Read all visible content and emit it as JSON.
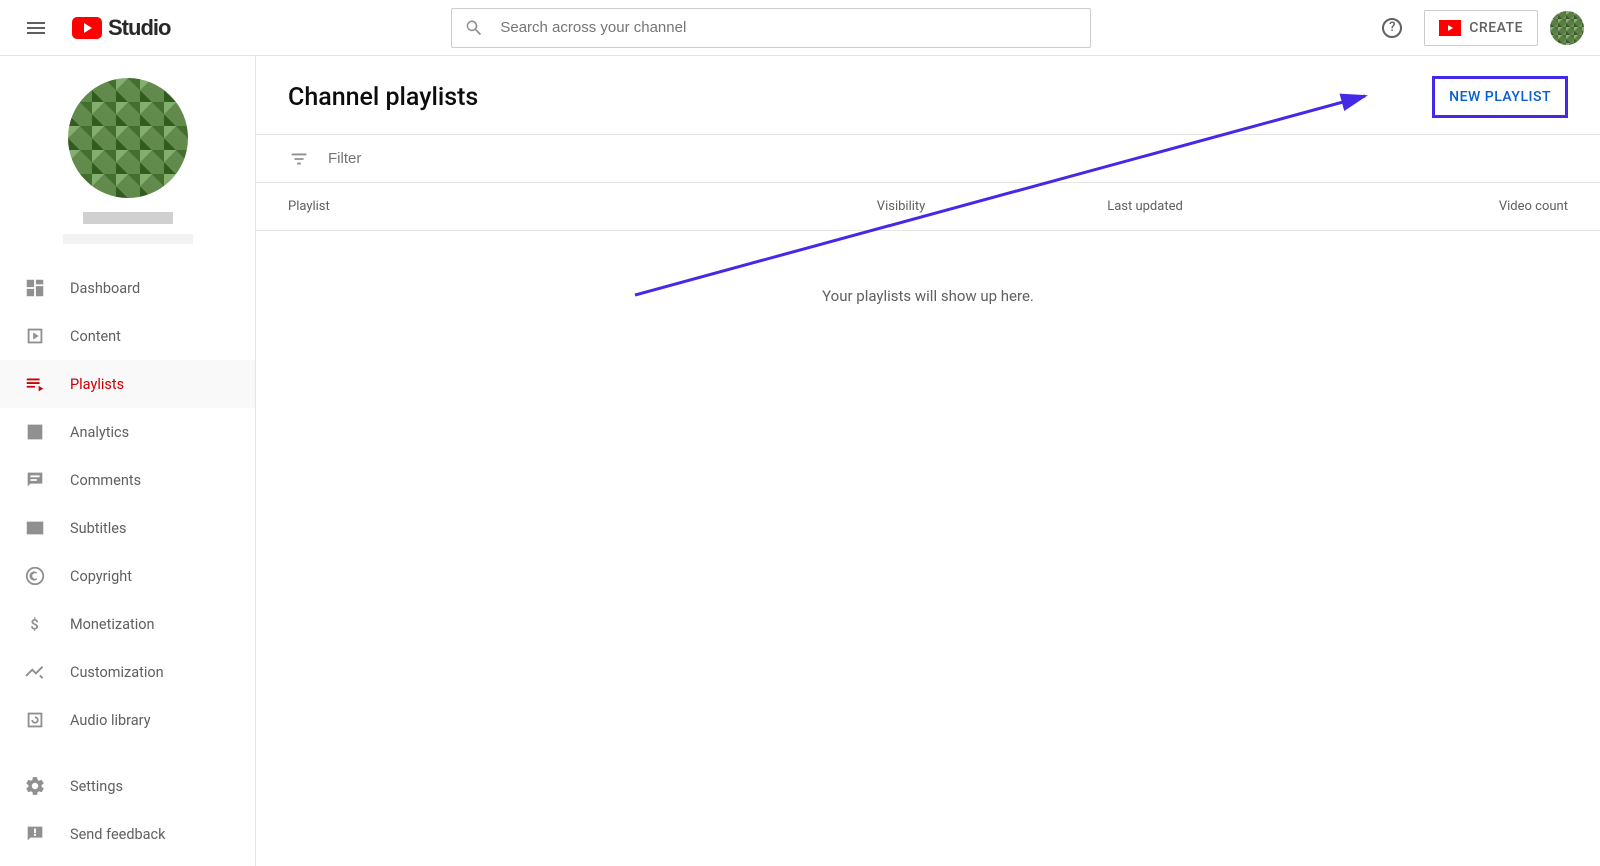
{
  "header": {
    "studio_text": "Studio",
    "search_placeholder": "Search across your channel",
    "create_label": "CREATE"
  },
  "sidebar": {
    "items": [
      {
        "label": "Dashboard",
        "icon": "dashboard"
      },
      {
        "label": "Content",
        "icon": "content"
      },
      {
        "label": "Playlists",
        "icon": "playlists",
        "active": true
      },
      {
        "label": "Analytics",
        "icon": "analytics"
      },
      {
        "label": "Comments",
        "icon": "comments"
      },
      {
        "label": "Subtitles",
        "icon": "subtitles"
      },
      {
        "label": "Copyright",
        "icon": "copyright"
      },
      {
        "label": "Monetization",
        "icon": "monetization"
      },
      {
        "label": "Customization",
        "icon": "customization"
      },
      {
        "label": "Audio library",
        "icon": "audio"
      }
    ],
    "bottom_items": [
      {
        "label": "Settings",
        "icon": "settings"
      },
      {
        "label": "Send feedback",
        "icon": "feedback"
      }
    ]
  },
  "main": {
    "page_title": "Channel playlists",
    "new_playlist_label": "NEW PLAYLIST",
    "filter_placeholder": "Filter",
    "columns": {
      "playlist": "Playlist",
      "visibility": "Visibility",
      "last_updated": "Last updated",
      "video_count": "Video count"
    },
    "empty_message": "Your playlists will show up here."
  },
  "annotation": {
    "arrow_color": "#4429e6"
  }
}
